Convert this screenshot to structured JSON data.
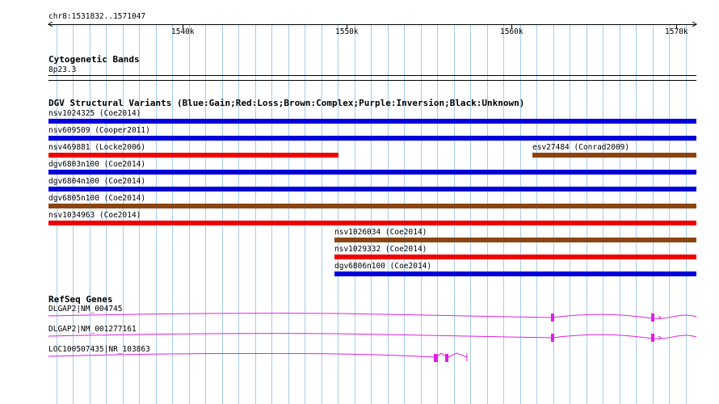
{
  "ruler": {
    "range_label": "chr8:1531832..1571047",
    "ticks": [
      "1540k",
      "1550k",
      "1560k",
      "1570k"
    ]
  },
  "cytobands": {
    "title": "Cytogenetic Bands",
    "band": "8p23.3"
  },
  "dgv": {
    "title": "DGV Structural Variants (Blue:Gain;Red:Loss;Brown:Complex;Purple:Inversion;Black:Unknown)",
    "colors": {
      "gain": "#0000dd",
      "loss": "#ee0000",
      "complex": "#8b4513"
    },
    "variants": [
      {
        "label": "nsv1024325 (Coe2014)",
        "type": "gain"
      },
      {
        "label": "nsv609509 (Cooper2011)",
        "type": "gain"
      },
      {
        "label": "nsv469881 (Locke2006)",
        "type": "loss"
      },
      {
        "label": "esv27484 (Conrad2009)",
        "type": "complex"
      },
      {
        "label": "dgv6803n100 (Coe2014)",
        "type": "gain"
      },
      {
        "label": "dgv6804n100 (Coe2014)",
        "type": "gain"
      },
      {
        "label": "dgv6805n100 (Coe2014)",
        "type": "complex"
      },
      {
        "label": "nsv1034963 (Coe2014)",
        "type": "loss"
      },
      {
        "label": "nsv1026034 (Coe2014)",
        "type": "complex"
      },
      {
        "label": "nsv1029332 (Coe2014)",
        "type": "loss"
      },
      {
        "label": "dgv6806n100 (Coe2014)",
        "type": "gain"
      }
    ]
  },
  "refseq": {
    "title": "RefSeq Genes",
    "color": "#e020e0",
    "genes": [
      {
        "label": "DLGAP2|NM_004745"
      },
      {
        "label": "DLGAP2|NM_001277161"
      },
      {
        "label": "LOC100507435|NR_103863"
      }
    ]
  }
}
